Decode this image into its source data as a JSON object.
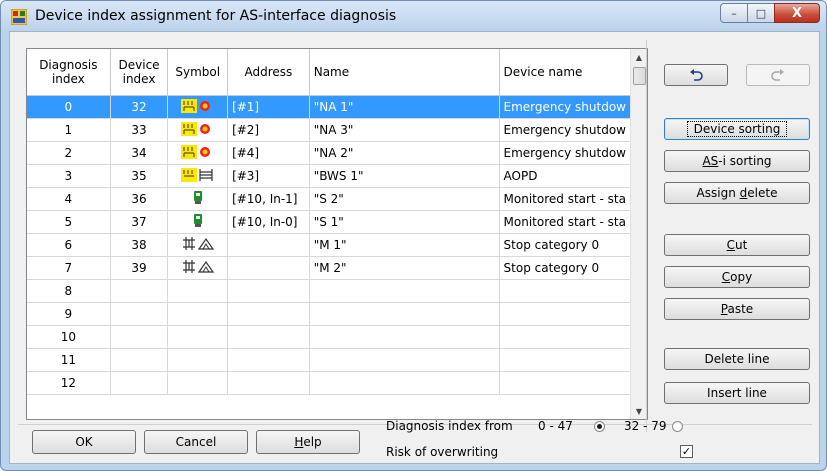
{
  "window": {
    "title": "Device index assignment for AS-interface diagnosis",
    "controls": {
      "minimize": "–",
      "maximize": "□",
      "close": "X"
    }
  },
  "table": {
    "headers": {
      "diag": "Diagnosis index",
      "dev": "Device index",
      "symbol": "Symbol",
      "address": "Address",
      "name": "Name",
      "devname": "Device name"
    },
    "rows": [
      {
        "diag": "0",
        "dev": "32",
        "symbol": "estop",
        "address": "[#1]",
        "name": "\"NA 1\"",
        "devname": "Emergency shutdow",
        "selected": true
      },
      {
        "diag": "1",
        "dev": "33",
        "symbol": "estop",
        "address": "[#2]",
        "name": "\"NA 3\"",
        "devname": "Emergency shutdow"
      },
      {
        "diag": "2",
        "dev": "34",
        "symbol": "estop",
        "address": "[#4]",
        "name": "\"NA 2\"",
        "devname": "Emergency shutdow"
      },
      {
        "diag": "3",
        "dev": "35",
        "symbol": "aopd",
        "address": "[#3]",
        "name": "\"BWS 1\"",
        "devname": "AOPD"
      },
      {
        "diag": "4",
        "dev": "36",
        "symbol": "monitor",
        "address": "[#10, In-1]",
        "name": "\"S 2\"",
        "devname": "Monitored start - sta"
      },
      {
        "diag": "5",
        "dev": "37",
        "symbol": "monitor",
        "address": "[#10, In-0]",
        "name": "\"S 1\"",
        "devname": "Monitored start - sta"
      },
      {
        "diag": "6",
        "dev": "38",
        "symbol": "stop",
        "address": "",
        "name": "\"M 1\"",
        "devname": "Stop category 0"
      },
      {
        "diag": "7",
        "dev": "39",
        "symbol": "stop",
        "address": "",
        "name": "\"M 2\"",
        "devname": "Stop category 0"
      },
      {
        "diag": "8",
        "dev": "",
        "symbol": "",
        "address": "",
        "name": "",
        "devname": ""
      },
      {
        "diag": "9",
        "dev": "",
        "symbol": "",
        "address": "",
        "name": "",
        "devname": ""
      },
      {
        "diag": "10",
        "dev": "",
        "symbol": "",
        "address": "",
        "name": "",
        "devname": ""
      },
      {
        "diag": "11",
        "dev": "",
        "symbol": "",
        "address": "",
        "name": "",
        "devname": ""
      },
      {
        "diag": "12",
        "dev": "",
        "symbol": "",
        "address": "",
        "name": "",
        "devname": ""
      }
    ]
  },
  "side_buttons": {
    "undo_icon": "undo-icon",
    "redo_icon": "redo-icon",
    "device_sorting": "Device sorting",
    "asi_sorting_pre": "AS",
    "asi_sorting_u": "-i",
    "asi_sorting_post": " sorting",
    "assign_delete_pre": "Assign ",
    "assign_delete_u": "d",
    "assign_delete_post": "elete",
    "cut_u": "C",
    "cut_post": "ut",
    "copy_u": "C",
    "copy_post": "opy",
    "paste_u": "P",
    "paste_post": "aste",
    "delete_line": "Delete line",
    "insert_line": "Insert line"
  },
  "footer": {
    "ok": "OK",
    "cancel": "Cancel",
    "help_u": "H",
    "help_post": "elp",
    "diag_from_label": "Diagnosis index from",
    "range1": "0 - 47",
    "range2": "32 - 79",
    "range1_checked": true,
    "range2_checked": false,
    "overwrite_label": "Risk of overwriting",
    "overwrite_checked": true,
    "check_mark": "✓"
  }
}
